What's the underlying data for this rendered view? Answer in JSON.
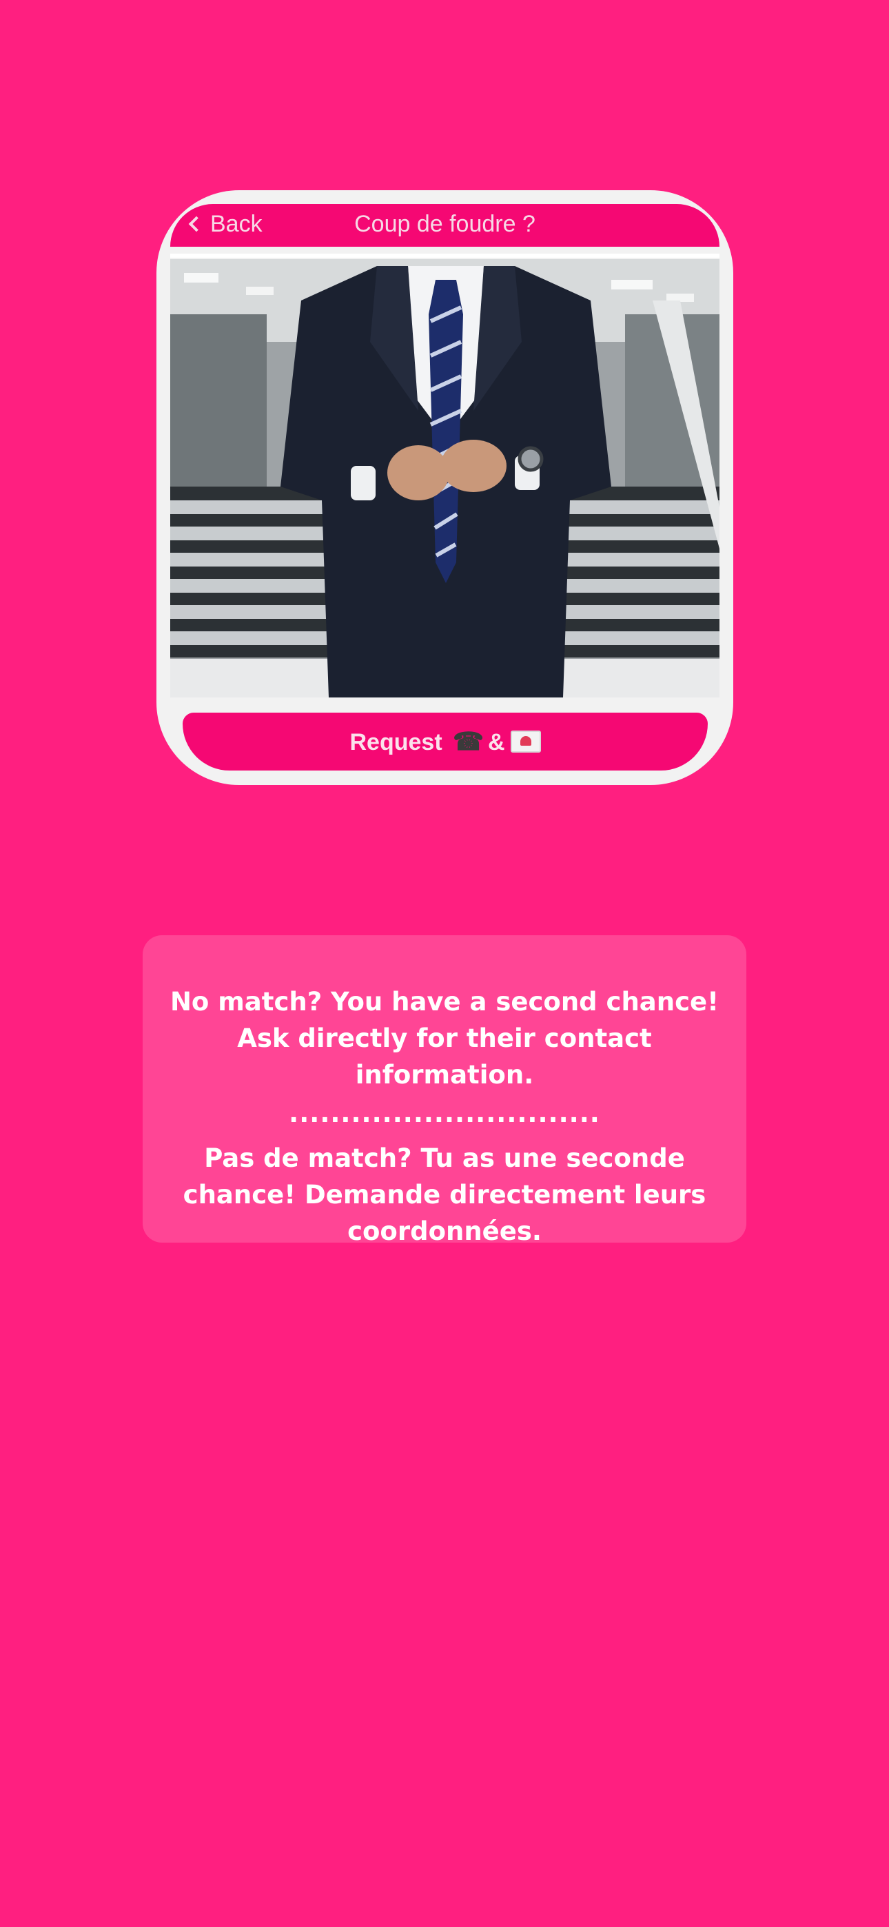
{
  "colors": {
    "background": "#ff1f80",
    "accent": "#f50873",
    "info_box": "#ff4595"
  },
  "phone": {
    "back_label": "Back",
    "title": "Coup de foudre ?",
    "request_label": "Request",
    "request_amp": "&",
    "request_icons": [
      "phone-icon",
      "love-letter-icon"
    ]
  },
  "info": {
    "english": "No match? You have a second chance! Ask directly for their contact information.",
    "separator": "..............................",
    "french": "Pas de match? Tu as une seconde chance! Demande directement leurs coordonnées."
  }
}
